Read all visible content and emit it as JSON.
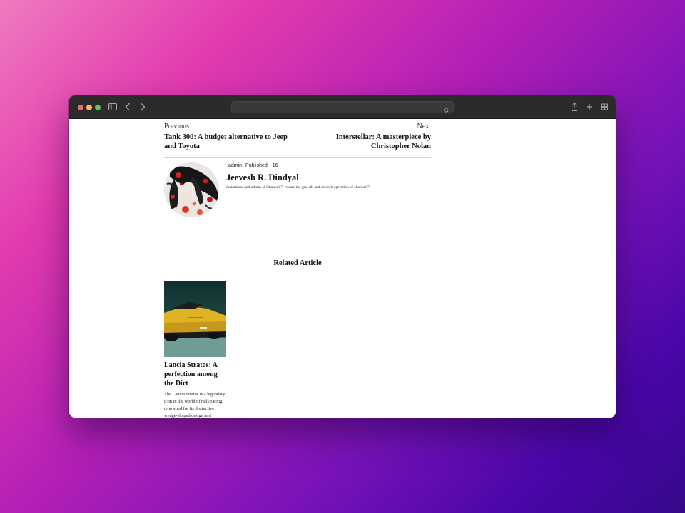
{
  "browser": {
    "controls": [
      "close",
      "minimize",
      "zoom"
    ],
    "icons": [
      "sidebar-icon",
      "back-icon",
      "forward-icon",
      "reload-icon",
      "share-icon",
      "new-tab-icon",
      "tab-overview-icon"
    ]
  },
  "post_navigation": {
    "previous": {
      "label": "Previous",
      "title": "Tank 300: A budget alternative to Jeep and Toyota"
    },
    "next": {
      "label": "Next",
      "title": "Interstellar: A masterpiece by Christopher Nolan"
    }
  },
  "author": {
    "role": "admin",
    "published_label": "Published:",
    "published_value": "16",
    "name": "Jeevesh R. Dindyal",
    "bio": "maintainer and admin of Channel 7, ensure the growth and smooth operation of channel 7"
  },
  "related": {
    "heading": "Related Article",
    "articles": [
      {
        "title": "Lancia Stratos: A perfection among the Dirt",
        "excerpt": "The Lancia Stratos is a legendary icon in the world of rally racing, renowned for its distinctive wedge-shaped design and formidable performance on the track. Introduced in the ..."
      }
    ]
  },
  "colors": {
    "toolbar": "#2d2a2c",
    "traffic_red": "#ed6a5e",
    "traffic_yellow": "#f5bf4f",
    "traffic_green": "#61c554",
    "card_car": "#e0b325"
  }
}
